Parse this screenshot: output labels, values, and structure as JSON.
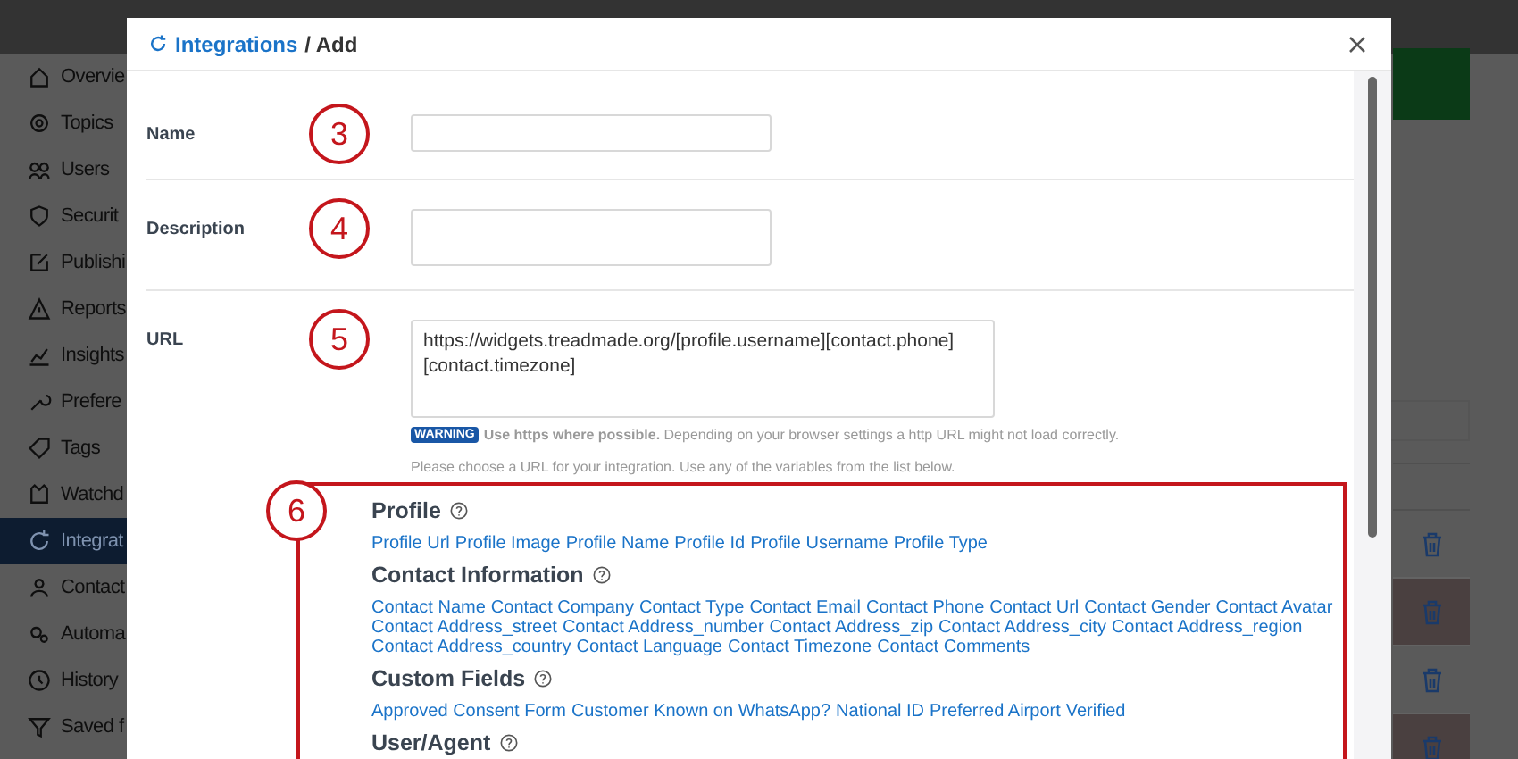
{
  "sidebar": {
    "items": [
      {
        "label": "Overvie",
        "selected": false
      },
      {
        "label": "Topics",
        "selected": false
      },
      {
        "label": "Users",
        "selected": false
      },
      {
        "label": "Securit",
        "selected": false
      },
      {
        "label": "Publishi",
        "selected": false
      },
      {
        "label": "Reports",
        "selected": false
      },
      {
        "label": "Insights",
        "selected": false
      },
      {
        "label": "Prefere",
        "selected": false
      },
      {
        "label": "Tags",
        "selected": false
      },
      {
        "label": "Watchd",
        "selected": false
      },
      {
        "label": "Integrat",
        "selected": true
      },
      {
        "label": "Contact",
        "selected": false
      },
      {
        "label": "Automa",
        "selected": false
      },
      {
        "label": "History",
        "selected": false
      },
      {
        "label": "Saved f",
        "selected": false
      }
    ]
  },
  "background_table": {
    "rows": [
      {
        "highlighted": false
      },
      {
        "highlighted": true
      },
      {
        "highlighted": false
      },
      {
        "highlighted": true
      }
    ]
  },
  "dialog": {
    "breadcrumb_link": "Integrations",
    "breadcrumb_current": "/ Add",
    "fields": [
      {
        "label": "Name",
        "kind": "input",
        "annotation": "3"
      },
      {
        "label": "Description",
        "kind": "textarea",
        "annotation": "4"
      },
      {
        "label": "URL",
        "kind": "url",
        "annotation": "5",
        "value": "https://widgets.treadmade.org/[profile.username][contact.phone]\n[contact.timezone]",
        "warning_badge": "WARNING",
        "warning": "**Use https where possible.** Depending on your browser settings a http URL might not load correctly.",
        "help": "Please choose a URL for your integration. Use any of the variables from the list below."
      }
    ],
    "variables_annotation": "6",
    "variable_groups": [
      {
        "title": "Profile",
        "variables": [
          "Profile Url",
          "Profile Image",
          "Profile Name",
          "Profile Id",
          "Profile Username",
          "Profile Type"
        ]
      },
      {
        "title": "Contact Information",
        "variables": [
          "Contact Name",
          "Contact Company",
          "Contact Type",
          "Contact Email",
          "Contact Phone",
          "Contact Url",
          "Contact Gender",
          "Contact Avatar",
          "Contact Address_street",
          "Contact Address_number",
          "Contact Address_zip",
          "Contact Address_city",
          "Contact Address_region",
          "Contact Address_country",
          "Contact Language",
          "Contact Timezone",
          "Contact Comments"
        ]
      },
      {
        "title": "Custom Fields",
        "variables": [
          "Approved Consent Form",
          "Customer Known on WhatsApp?",
          "National ID",
          "Preferred Airport",
          "Verified"
        ]
      },
      {
        "title": "User/Agent"
      }
    ]
  }
}
